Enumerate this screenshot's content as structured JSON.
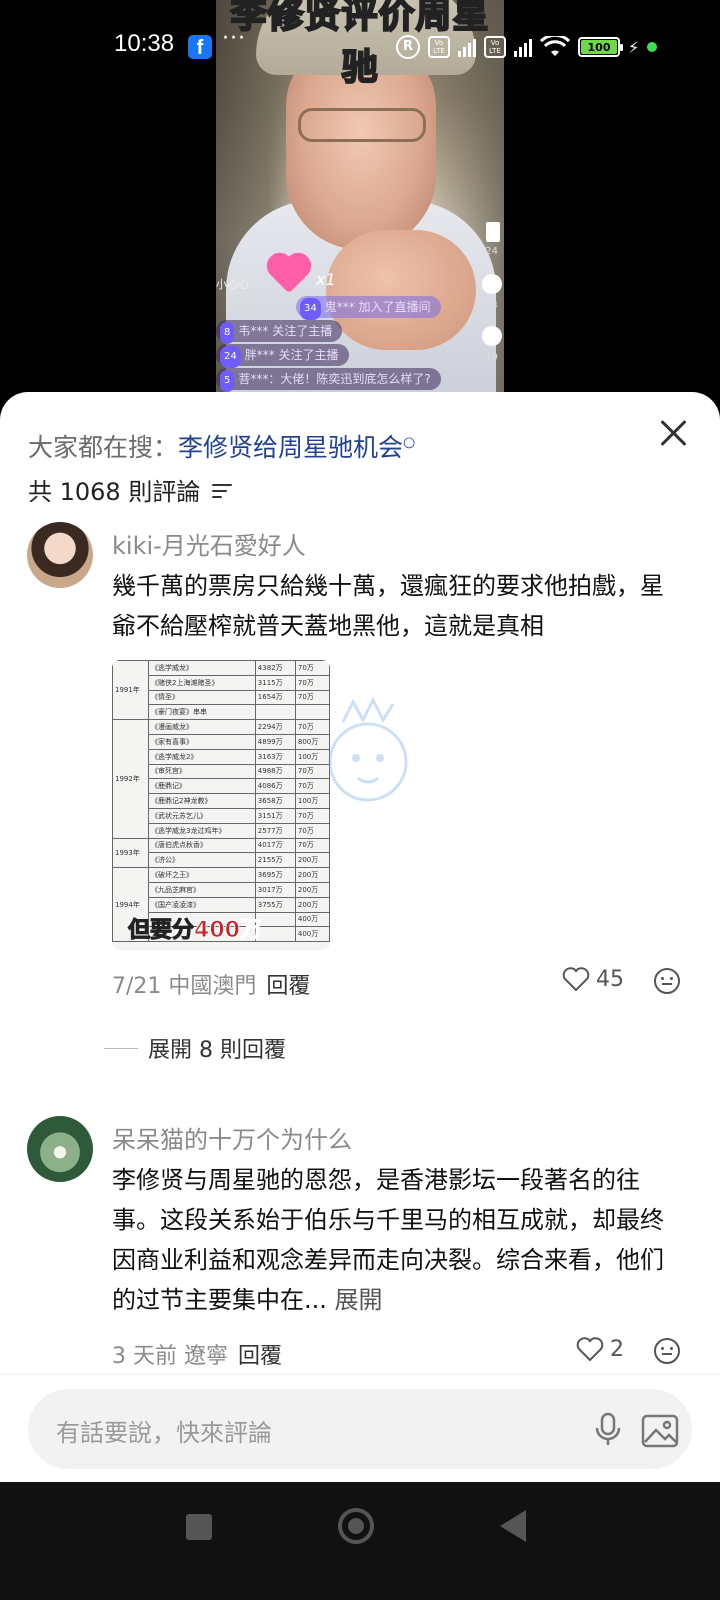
{
  "video": {
    "title_overlay": "李修贤评价周星驰",
    "like_label": "小心心",
    "like_count_label": "x1",
    "join_notice": "鬼*** 加入了直播间",
    "events": [
      {
        "level": "8",
        "text": "韦*** 关注了主播"
      },
      {
        "level": "24",
        "text": "胖*** 关注了主播"
      },
      {
        "level": "5",
        "text": "菩***：大佬！陈奕迅到底怎么样了?"
      }
    ],
    "join_level": "34",
    "side_counts": [
      "124",
      "124",
      "19"
    ]
  },
  "status_bar": {
    "time": "10:38",
    "facebook": "f",
    "more": "···",
    "battery": "100",
    "volte_label": "Vo LTE",
    "r_label": "R"
  },
  "sheet": {
    "search_prefix": "大家都在搜：",
    "search_keyword": "李修贤给周星驰机会",
    "comment_count": "共 1068 則評論"
  },
  "comments": [
    {
      "username": "kiki-月光石愛好人",
      "text": "幾千萬的票房只給幾十萬，還瘋狂的要求他拍戲，星爺不給壓榨就普天蓋地黑他，這就是真相",
      "date_location": "7/21 中國澳門",
      "reply_label": "回覆",
      "likes": "45",
      "replies_toggle": "展開 8 則回覆"
    },
    {
      "username": "呆呆猫的十万个为什么",
      "text": "李修贤与周星驰的恩怨，是香港影坛一段著名的往事。这段关系始于伯乐与千里马的相互成就，却最终因商业利益和观念差异而走向决裂。综合来看，他们的过节主要集中在...",
      "expand_label": "展開",
      "date_location": "3 天前 遼寧",
      "reply_label": "回覆",
      "likes": "2"
    }
  ],
  "thumbnail": {
    "caption_prefix": "但要分",
    "caption_highlight": "400万",
    "years": [
      "1991年",
      "1992年",
      "1993年",
      "1994年"
    ],
    "rows": [
      [
        "《逃学威龙》",
        "4382万",
        "70万"
      ],
      [
        "《赌侠2上海滩赌圣》",
        "3115万",
        "70万"
      ],
      [
        "《情圣》",
        "1654万",
        "70万"
      ],
      [
        "《豪门夜宴》串串",
        "",
        ""
      ],
      [
        "《漫画威龙》",
        "2294万",
        "70万"
      ],
      [
        "《家有喜事》",
        "4899万",
        "800万"
      ],
      [
        "《逃学威龙2》",
        "3163万",
        "100万"
      ],
      [
        "《审死官》",
        "4988万",
        "70万"
      ],
      [
        "《鹿鼎记》",
        "4086万",
        "70万"
      ],
      [
        "《鹿鼎记2神龙教》",
        "3658万",
        "100万"
      ],
      [
        "《武状元苏乞儿》",
        "3151万",
        "70万"
      ],
      [
        "《逃学威龙3龙过鸡年》",
        "2577万",
        "70万"
      ],
      [
        "《唐伯虎点秋香》",
        "4017万",
        "70万"
      ],
      [
        "《济公》",
        "2155万",
        "200万"
      ],
      [
        "《破坏之王》",
        "3695万",
        "200万"
      ],
      [
        "《九品芝麻官》",
        "3017万",
        "200万"
      ],
      [
        "《国产凌凌漆》",
        "3755万",
        "200万"
      ],
      [
        "",
        "",
        "400万"
      ],
      [
        "",
        "",
        "400万"
      ]
    ]
  },
  "input_bar": {
    "placeholder": "有話要說，快來評論"
  },
  "colors": {
    "keyword": "#23428f",
    "battery": "#6fd84a",
    "facebook": "#1877f2"
  }
}
